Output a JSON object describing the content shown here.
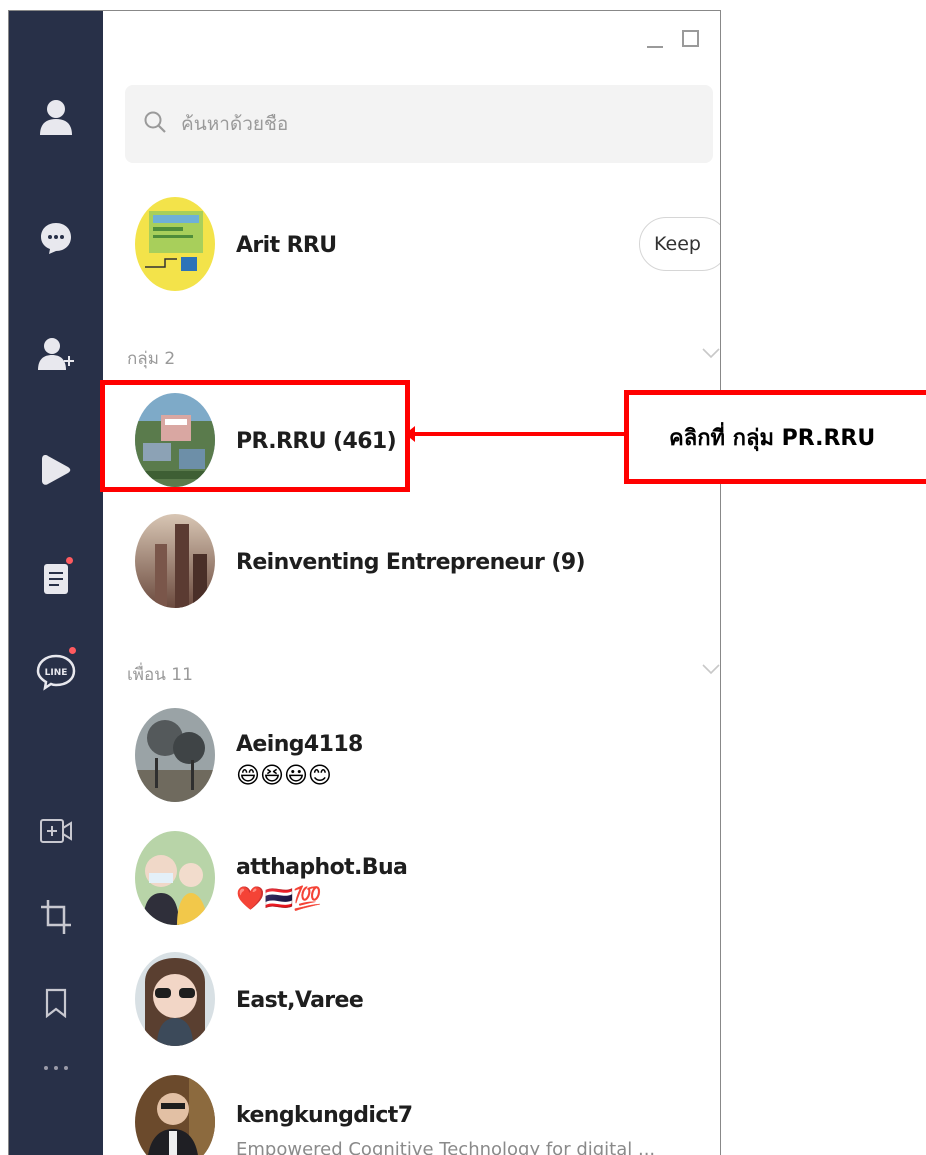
{
  "search": {
    "placeholder": "ค้นหาด้วยชื่อ"
  },
  "keep": {
    "name": "Arit RRU",
    "button_label": "Keep"
  },
  "groups": {
    "header": "กลุ่ม 2",
    "items": [
      {
        "name": "PR.RRU (461)"
      },
      {
        "name": "Reinventing Entrepreneur (9)"
      }
    ]
  },
  "friends": {
    "header": "เพื่อน 11",
    "items": [
      {
        "name": "Aeing4118",
        "status": "😄😆😃😊"
      },
      {
        "name": "atthaphot.Bua",
        "status": "❤️🇹🇭💯"
      },
      {
        "name": "East,Varee",
        "status": ""
      },
      {
        "name": "kengkungdict7",
        "status": "Empowered Cognitive Technology  for digital ..."
      }
    ]
  },
  "annotation": {
    "callout_text": "คลิกที่ กลุ่ม PR.RRU",
    "color": "#ff0000"
  },
  "sidebar": {
    "icons": [
      "person-icon",
      "chat-icon",
      "add-friend-icon",
      "play-icon",
      "note-icon",
      "line-icon",
      "video-call-icon",
      "crop-icon",
      "bookmark-icon",
      "more-icon"
    ]
  }
}
